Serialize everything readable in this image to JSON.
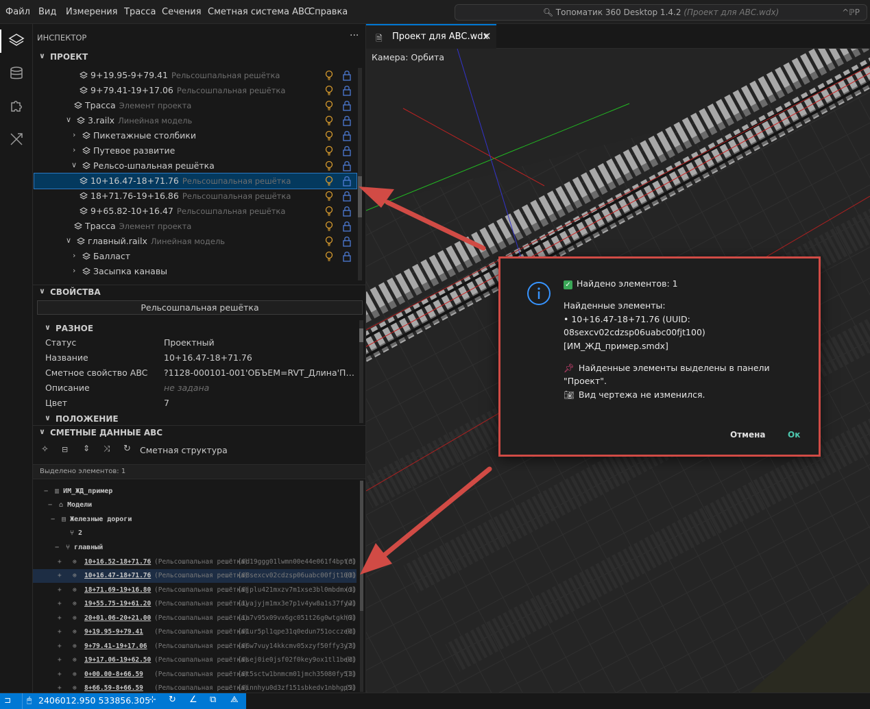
{
  "menu": [
    "Файл",
    "Вид",
    "Измерения",
    "Трасса",
    "Сечения",
    "Сметная система ABC",
    "Справка"
  ],
  "command_center": {
    "app": "Топоматик 360 Desktop 1.4.2",
    "project": "(Проект для ABC.wdx)",
    "shortcut": "^ℙP"
  },
  "inspector": {
    "title": "ИНСПЕКТОР",
    "more": "···",
    "project_header": "ПРОЕКТ",
    "tree": [
      {
        "name": "9+19.95-9+79.41",
        "type": "Рельсошпальная решётка"
      },
      {
        "name": "9+79.41-19+17.06",
        "type": "Рельсошпальная решётка"
      },
      {
        "name": "Трасса",
        "type": "Элемент проекта"
      },
      {
        "name": "3.railx",
        "type": "Линейная модель"
      },
      {
        "name": "Пикетажные столбики",
        "type": ""
      },
      {
        "name": "Путевое развитие",
        "type": ""
      },
      {
        "name": "Рельсо-шпальная решётка",
        "type": ""
      },
      {
        "name": "10+16.47-18+71.76",
        "type": "Рельсошпальная решётка"
      },
      {
        "name": "18+71.76-19+16.86",
        "type": "Рельсошпальная решётка"
      },
      {
        "name": "9+65.82-10+16.47",
        "type": "Рельсошпальная решётка"
      },
      {
        "name": "Трасса",
        "type": "Элемент проекта"
      },
      {
        "name": "главный.railx",
        "type": "Линейная модель"
      },
      {
        "name": "Балласт",
        "type": ""
      },
      {
        "name": "Засыпка канавы",
        "type": ""
      }
    ]
  },
  "properties": {
    "header": "СВОЙСТВА",
    "object_type": "Рельсошпальная решётка",
    "group_misc": "РАЗНОЕ",
    "rows": [
      {
        "key": "Статус",
        "value": "Проектный"
      },
      {
        "key": "Название",
        "value": "10+16.47-18+71.76"
      },
      {
        "key": "Сметное свойство ABC",
        "value": "?1128-000101-001'ОБЪЕМ=RVT_Длина'ПОП..."
      },
      {
        "key": "Описание",
        "value": "не задана"
      },
      {
        "key": "Цвет",
        "value": "7"
      }
    ],
    "group_position": "ПОЛОЖЕНИЕ"
  },
  "estimate": {
    "header": "СМЕТНЫЕ ДАННЫЕ ABC",
    "toolbar_label": "Сметная структура",
    "selected_count": "Выделено элементов: 1",
    "groups": [
      {
        "minus": "−",
        "name": "ИМ_ЖД_пример"
      },
      {
        "minus": "−",
        "name": "Модели"
      },
      {
        "minus": "−",
        "name": "Железные дороги"
      },
      {
        "minus": "",
        "name": "2"
      },
      {
        "minus": "−",
        "name": "главный"
      }
    ],
    "rows": [
      {
        "name": "10+16.52-18+71.76",
        "type": "(Рельсошпальная решётка)",
        "uuid": "[0d19ggg01lwmn00e44e061f4bptr]",
        "count": "(3)"
      },
      {
        "name": "10+16.47-18+71.76",
        "type": "(Рельсошпальная решётка)",
        "uuid": "[08sexcv02cdzsp06uabc00fjt100]",
        "count": "(3)"
      },
      {
        "name": "18+71.69-19+16.80",
        "type": "(Рельсошпальная решётка)",
        "uuid": "[0jplu421mxzv7m1xse3bl0mbdmxo]",
        "count": "(3)"
      },
      {
        "name": "19+55.75-19+61.20",
        "type": "(Рельсошпальная решётка)",
        "uuid": "[1yajyjm1mx3e7p1v4yw8a1s37fyw]",
        "count": "(3)"
      },
      {
        "name": "20+01.06-20+21.00",
        "type": "(Рельсошпальная решётка)",
        "uuid": "[1a7v95x09vx6gc051t26g0wtgkh6]",
        "count": "(3)"
      },
      {
        "name": "9+19.95-9+79.41",
        "type": "(Рельсошпальная решётка)",
        "uuid": "[01ur5pl1qpe31q0edun751occzek]",
        "count": "(3)"
      },
      {
        "name": "9+79.41-19+17.06",
        "type": "(Рельсошпальная решётка)",
        "uuid": "[06w7vuy14kkcmv05xzyf50ffy3y7]",
        "count": "(3)"
      },
      {
        "name": "19+17.06-19+62.50",
        "type": "(Рельсошпальная решётка)",
        "uuid": "[0sej0ie0jsf02f0key9ox1tl1bek]",
        "count": "(3)"
      },
      {
        "name": "0+00.00-8+66.59",
        "type": "(Рельсошпальная решётка)",
        "uuid": "[0t5sctw1bnmcm01jmch35080fy51]",
        "count": "(3)"
      },
      {
        "name": "8+66.59-8+66.59",
        "type": "(Рельсошпальная решётка)",
        "uuid": "[0innhyu0d3zf151sbkedv1nbhgp5]",
        "count": "(3)"
      }
    ]
  },
  "editor": {
    "tab_label": "Проект для ABC.wdx",
    "camera_label": "Камера: Орбита"
  },
  "dialog": {
    "found_line": "Найдено элементов: 1",
    "found_header": "Найденные элементы:",
    "item_line1": "• 10+16.47-18+71.76 (UUID:",
    "item_line2": "08sexcv02cdzsp06uabc00fjt100)",
    "item_line3": "[ИМ_ЖД_пример.smdx]",
    "note_line1": "Найденные элементы выделены в панели",
    "note_line2": "\"Проект\".",
    "note_line3": "Вид чертежа не изменился.",
    "cancel": "Отмена",
    "ok": "Ок"
  },
  "status": {
    "coords": "2406012.950 533856.305"
  },
  "colors": {
    "accent": "#0078d4",
    "selection": "#04395e",
    "annotation": "#d14b45",
    "ok_button": "#4ec9b0"
  }
}
